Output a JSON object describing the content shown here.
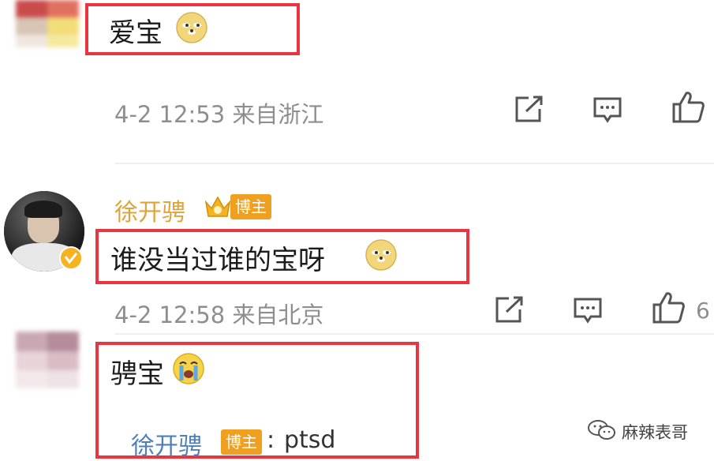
{
  "comments": [
    {
      "text": "爱宝",
      "emoji": "doge-emoji",
      "timestamp": "4-2 12:53 来自浙江"
    },
    {
      "username": "徐开骋",
      "badge": "博主",
      "text": "谁没当过谁的宝呀",
      "emoji": "doge-emoji",
      "timestamp": "4-2 12:58 来自北京",
      "like_count": "6"
    },
    {
      "text": "骋宝",
      "emoji": "crying-emoji",
      "reply": {
        "username": "徐开骋",
        "badge": "博主",
        "separator": ":",
        "text": "ptsd"
      }
    }
  ],
  "watermark": {
    "text": "麻辣表哥"
  },
  "colors": {
    "highlight_box": "#e8353f",
    "username_gold": "#e0a33a",
    "reply_username": "#4f7fb8",
    "badge": "#f0a020",
    "meta_gray": "#8e8e8e"
  }
}
